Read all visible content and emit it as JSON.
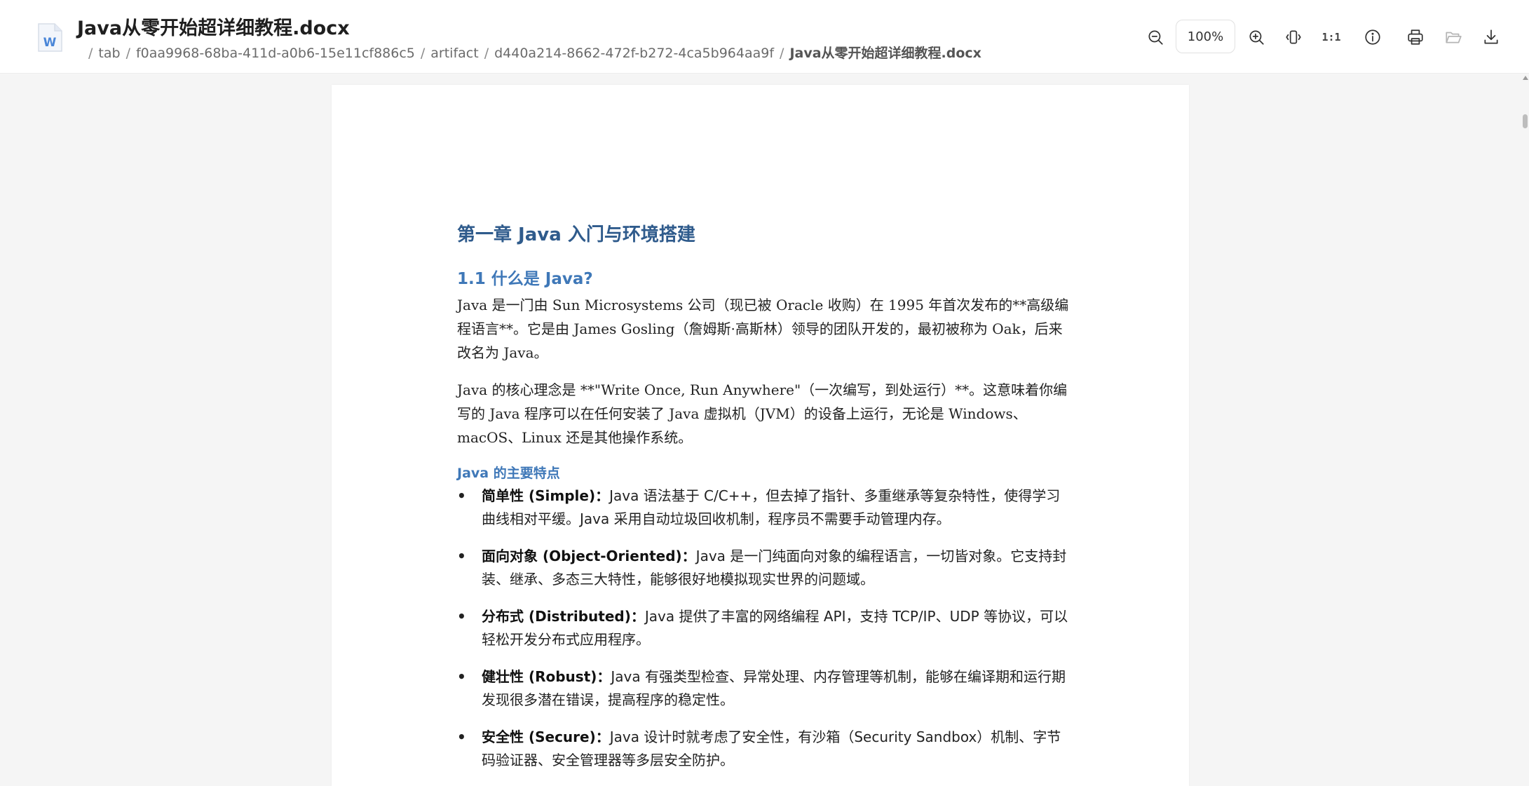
{
  "header": {
    "title": "Java从零开始超详细教程.docx",
    "file_icon_letter": "W",
    "breadcrumb": [
      "tab",
      "f0aa9968-68ba-411d-a0b6-15e11cf886c5",
      "artifact",
      "d440a214-8662-472f-b272-4ca5b964aa9f",
      "Java从零开始超详细教程.docx"
    ],
    "breadcrumb_separator": "/",
    "zoom_level": "100%",
    "one_to_one_label": "1:1",
    "icons": [
      "zoom-out-icon",
      "zoom-in-icon",
      "fit-width-icon",
      "actual-size-icon",
      "info-icon",
      "print-icon",
      "open-folder-icon",
      "download-icon"
    ]
  },
  "document": {
    "heading1": "第一章 Java 入门与环境搭建",
    "heading2": "1.1 什么是 Java?",
    "paragraphs": [
      "Java 是一门由 Sun Microsystems 公司（现已被 Oracle 收购）在 1995 年首次发布的**高级编程语言**。它是由 James Gosling（詹姆斯·高斯林）领导的团队开发的，最初被称为 Oak，后来改名为 Java。",
      "Java 的核心理念是 **\"Write Once, Run Anywhere\"（一次编写，到处运行）**。这意味着你编写的 Java 程序可以在任何安装了 Java 虚拟机（JVM）的设备上运行，无论是 Windows、macOS、Linux 还是其他操作系统。"
    ],
    "heading3": "Java 的主要特点",
    "bullet_char": "•",
    "bullets": [
      {
        "term": "简单性 (Simple)：",
        "text": "Java 语法基于 C/C++，但去掉了指针、多重继承等复杂特性，使得学习曲线相对平缓。Java 采用自动垃圾回收机制，程序员不需要手动管理内存。"
      },
      {
        "term": "面向对象 (Object-Oriented)：",
        "text": "Java 是一门纯面向对象的编程语言，一切皆对象。它支持封装、继承、多态三大特性，能够很好地模拟现实世界的问题域。"
      },
      {
        "term": "分布式 (Distributed)：",
        "text": "Java 提供了丰富的网络编程 API，支持 TCP/IP、UDP 等协议，可以轻松开发分布式应用程序。"
      },
      {
        "term": "健壮性 (Robust)：",
        "text": "Java 有强类型检查、异常处理、内存管理等机制，能够在编译期和运行期发现很多潜在错误，提高程序的稳定性。"
      },
      {
        "term": "安全性 (Secure)：",
        "text": "Java 设计时就考虑了安全性，有沙箱（Security Sandbox）机制、字节码验证器、安全管理器等多层安全防护。"
      }
    ]
  },
  "colors": {
    "heading1": "#2f5b8c",
    "heading2": "#3f78b8",
    "word_icon": "#4a86d8"
  }
}
